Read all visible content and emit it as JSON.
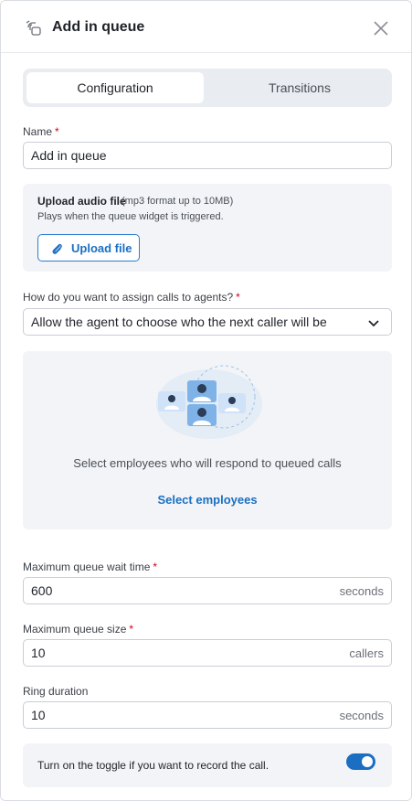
{
  "header": {
    "title": "Add in queue",
    "icon": "queue-icon",
    "close_icon": "close-icon"
  },
  "tabs": [
    {
      "label": "Configuration",
      "active": true
    },
    {
      "label": "Transitions",
      "active": false
    }
  ],
  "name_field": {
    "label": "Name",
    "required": "*",
    "value": "Add in queue"
  },
  "upload": {
    "title": "Upload audio file",
    "hint": "(mp3 format up to 10MB)",
    "subtitle": "Plays when the queue widget is triggered.",
    "button_label": "Upload file",
    "button_icon": "paperclip-icon"
  },
  "assign": {
    "label": "How do you want to assign calls to agents?",
    "required": "*",
    "selected": "Allow the agent to choose who the next caller will be"
  },
  "employees": {
    "text": "Select employees who will respond to queued calls",
    "link": "Select employees",
    "illustration": "employees-illustration"
  },
  "wait_time": {
    "label": "Maximum queue wait time",
    "required": "*",
    "value": "600",
    "unit": "seconds"
  },
  "queue_size": {
    "label": "Maximum queue size",
    "required": "*",
    "value": "10",
    "unit": "callers"
  },
  "ring_duration": {
    "label": "Ring duration",
    "value": "10",
    "unit": "seconds"
  },
  "record": {
    "text": "Turn on the toggle if you want to record the call.",
    "enabled": true
  },
  "colors": {
    "accent": "#1a6fc2",
    "toggle_on": "#1c6ec0",
    "required": "#d0021b"
  }
}
